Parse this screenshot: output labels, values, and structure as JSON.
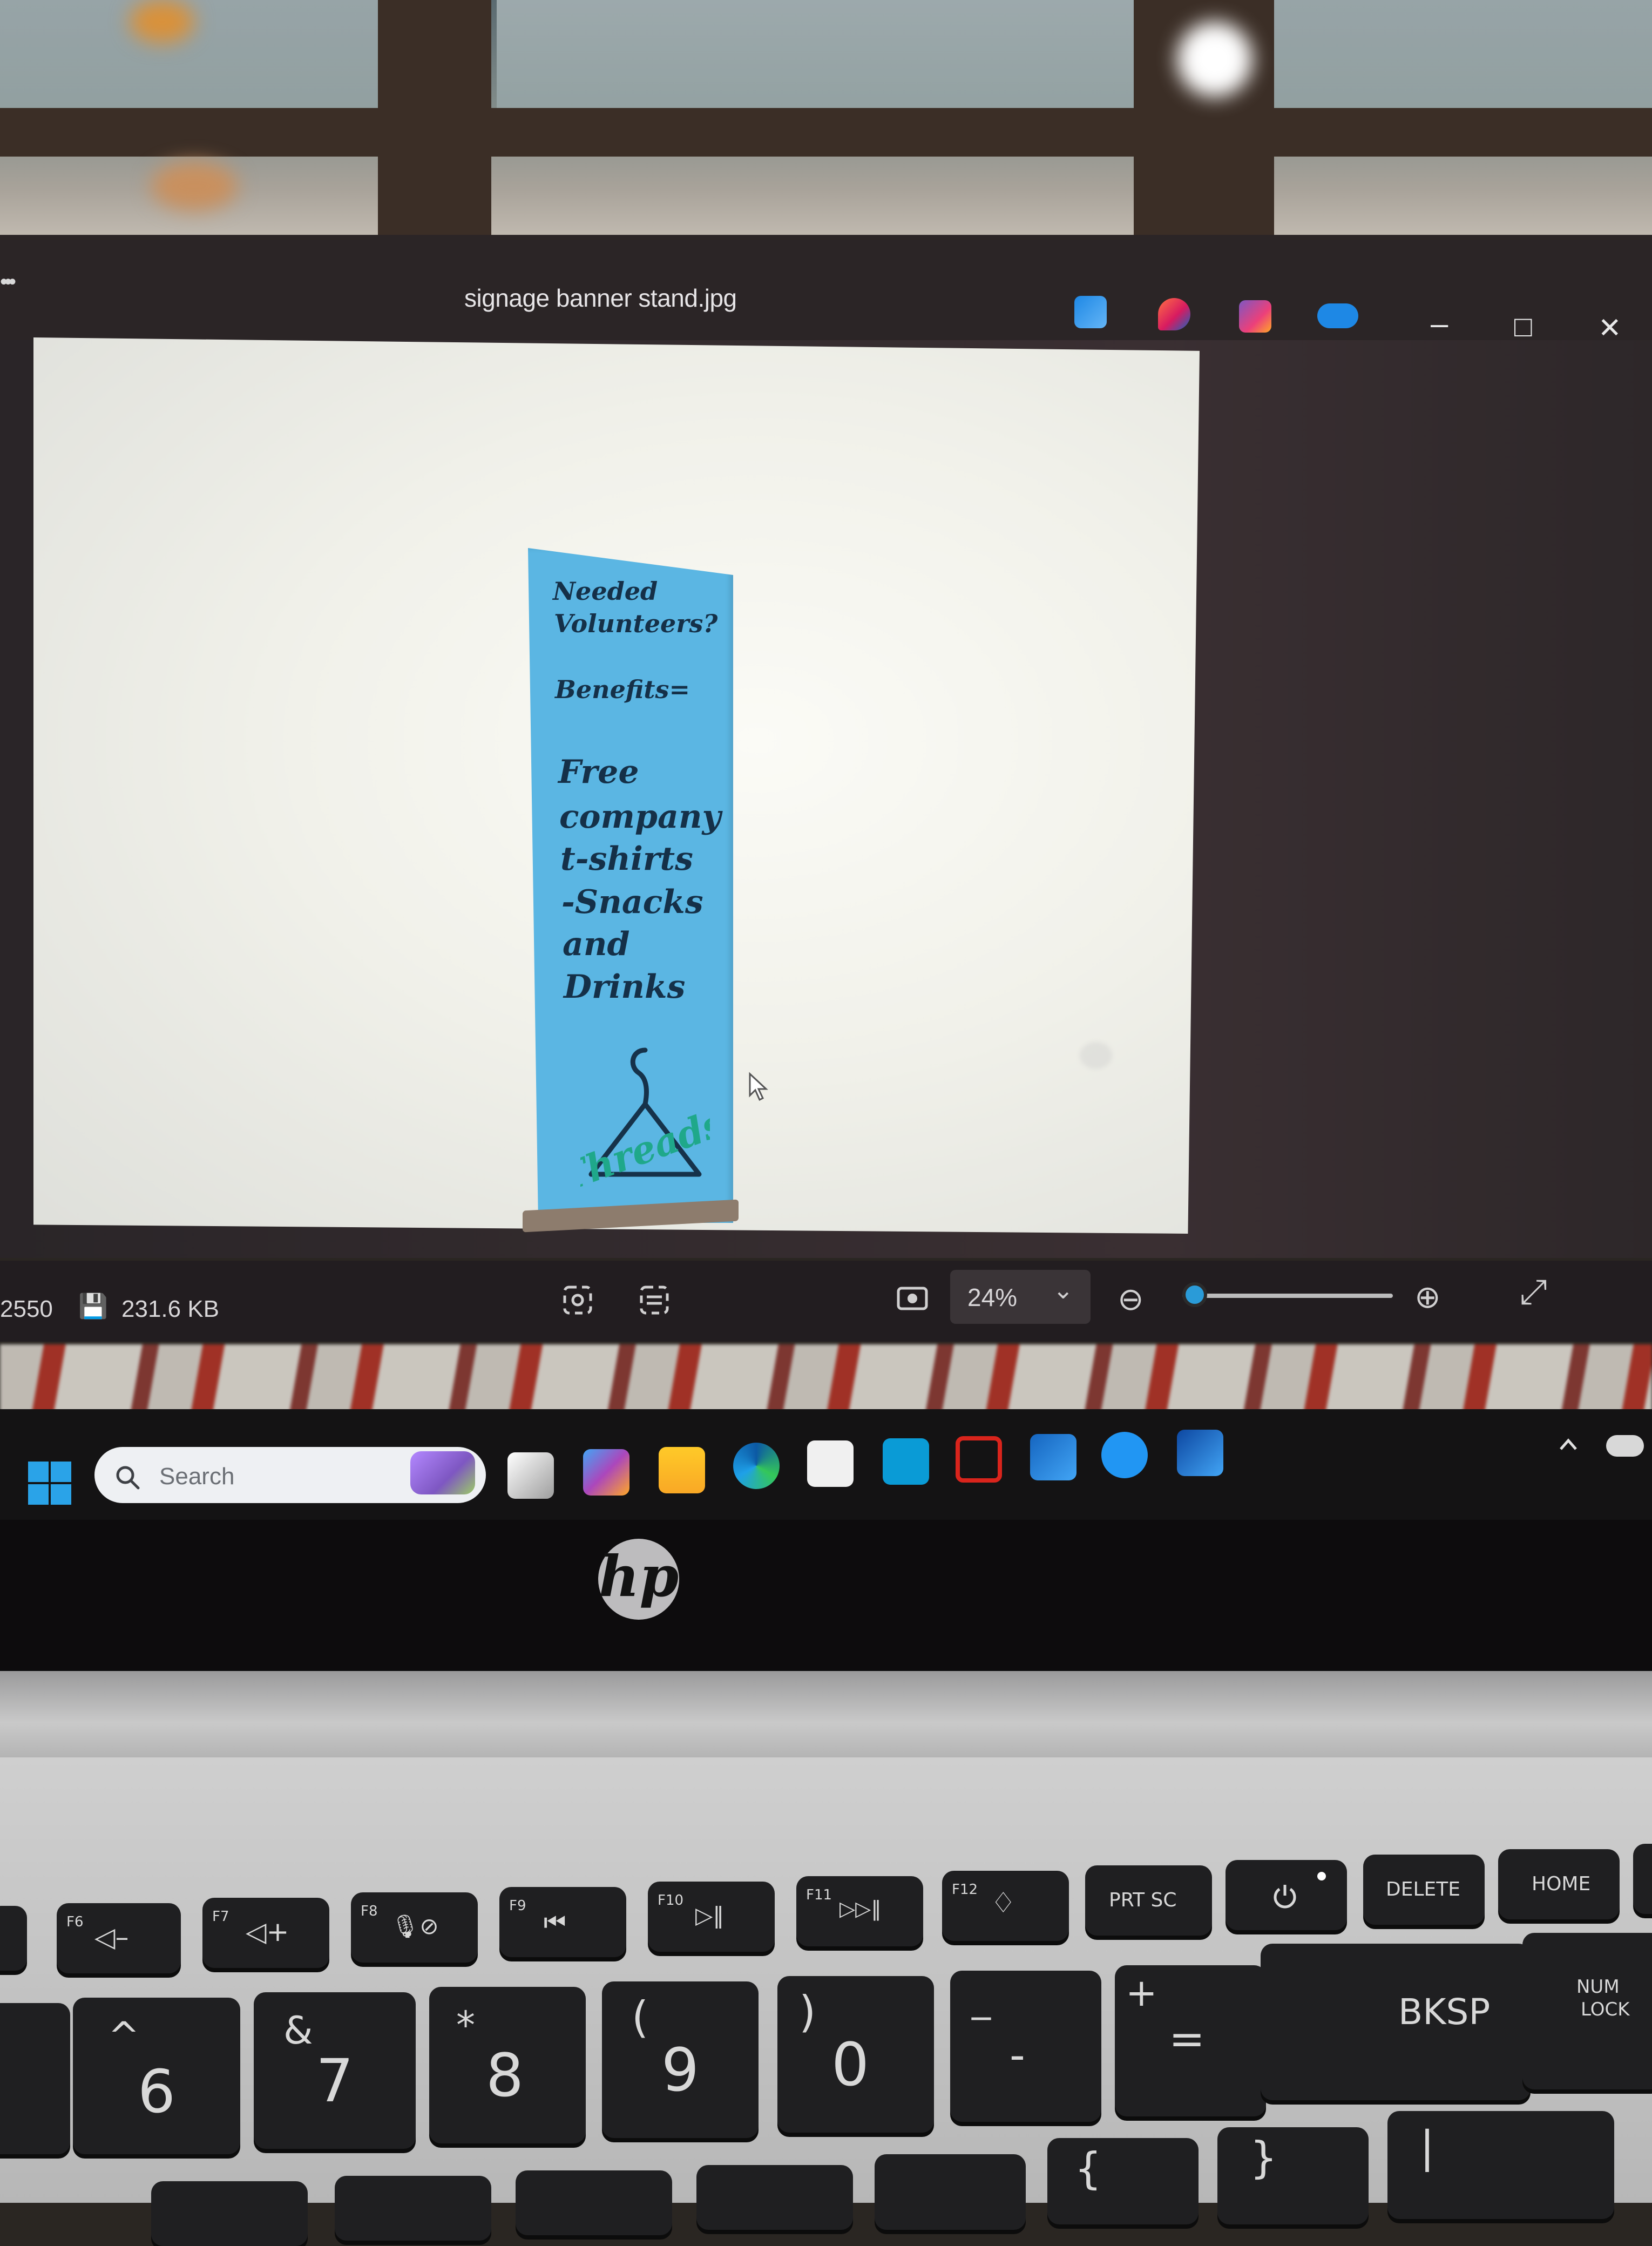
{
  "viewer": {
    "menu_glyph": "•••",
    "title": "signage banner stand.jpg",
    "window_controls": {
      "minimize": "–",
      "maximize": "□",
      "close": "✕"
    },
    "status": {
      "dimensions_tail": "2550",
      "save_icon": "💾",
      "file_size": "231.6 KB",
      "zoom_value": "24%",
      "zoom_dropdown_icon": "⌄",
      "zoom_out_icon": "⊖",
      "zoom_in_icon": "⊕",
      "fullscreen_icon": "⤢"
    }
  },
  "banner": {
    "line1": "Needed",
    "line2": "Volunteers?",
    "line3": "Benefits=",
    "line4": "Free",
    "line5": "company",
    "line6": "t-shirts",
    "line7": "-Snacks",
    "line8": "and",
    "line9": "Drinks",
    "logo_text": "Threads",
    "background_color": "#5bb6e3",
    "text_color": "#153048",
    "logo_color": "#1fa88a"
  },
  "taskbar": {
    "search_placeholder": "Search"
  },
  "laptop": {
    "brand_logo": "hp"
  },
  "keyboard": {
    "fn_row": [
      "F6",
      "F7",
      "F8",
      "F9",
      "F10",
      "F11",
      "F12",
      "PRT SC",
      "DELETE",
      "HOME"
    ],
    "fn_glyphs": [
      "◁–",
      "◁+",
      "🎙⊘",
      "⏮",
      "▷‖",
      "▷▷‖",
      "♢",
      "",
      "",
      ""
    ],
    "num_row_top": [
      "^",
      "&",
      "*",
      "(",
      ")",
      "_",
      "+"
    ],
    "num_row_bottom": [
      "6",
      "7",
      "8",
      "9",
      "0",
      "-",
      "="
    ],
    "bksp": "BKSP",
    "num_lock_line1": "NUM",
    "num_lock_line2": "LOCK",
    "bracket_open": "{",
    "bracket_close": "}",
    "pipe": "|"
  }
}
